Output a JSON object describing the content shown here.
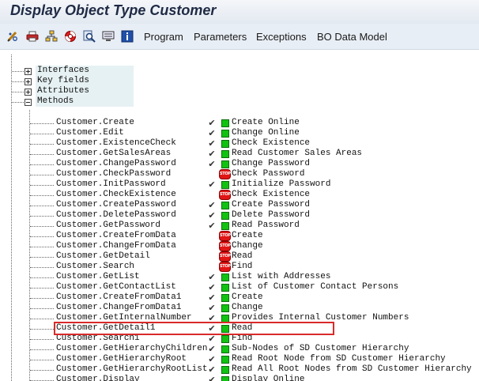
{
  "window": {
    "title": "Display Object Type Customer"
  },
  "toolbar": {
    "icons": [
      "pencil-glasses-icon",
      "printer-icon",
      "hierarchy-icon",
      "lifebuoy-icon",
      "magnifier-icon",
      "monitor-icon",
      "info-icon"
    ],
    "menus": [
      "Program",
      "Parameters",
      "Exceptions",
      "BO Data Model"
    ]
  },
  "tree": {
    "nodes": [
      "Interfaces",
      "Key fields",
      "Attributes",
      "Methods"
    ]
  },
  "status_icons": {
    "green": "green-square-icon",
    "stop": "stop-icon",
    "stop_text": "STOP",
    "check": "✔"
  },
  "methods": [
    {
      "name": "Customer.Create",
      "status": "ok",
      "desc": "Create Online"
    },
    {
      "name": "Customer.Edit",
      "status": "ok",
      "desc": "Change Online"
    },
    {
      "name": "Customer.ExistenceCheck",
      "status": "ok",
      "desc": "Check Existence"
    },
    {
      "name": "Customer.GetSalesAreas",
      "status": "ok",
      "desc": "Read Customer Sales Areas"
    },
    {
      "name": "Customer.ChangePassword",
      "status": "ok",
      "desc": "Change Password"
    },
    {
      "name": "Customer.CheckPassword",
      "status": "stop",
      "desc": "Check Password"
    },
    {
      "name": "Customer.InitPassword",
      "status": "ok",
      "desc": "Initialize Password"
    },
    {
      "name": "Customer.CheckExistence",
      "status": "stop",
      "desc": "Check Existence"
    },
    {
      "name": "Customer.CreatePassword",
      "status": "ok",
      "desc": "Create Password"
    },
    {
      "name": "Customer.DeletePassword",
      "status": "ok",
      "desc": "Delete Password"
    },
    {
      "name": "Customer.GetPassword",
      "status": "ok",
      "desc": "Read Password"
    },
    {
      "name": "Customer.CreateFromData",
      "status": "stop",
      "desc": "Create"
    },
    {
      "name": "Customer.ChangeFromData",
      "status": "stop",
      "desc": "Change"
    },
    {
      "name": "Customer.GetDetail",
      "status": "stop",
      "desc": "Read"
    },
    {
      "name": "Customer.Search",
      "status": "stop",
      "desc": "Find"
    },
    {
      "name": "Customer.GetList",
      "status": "ok",
      "desc": "List with Addresses",
      "highlighted": true
    },
    {
      "name": "Customer.GetContactList",
      "status": "ok",
      "desc": "List of Customer Contact Persons"
    },
    {
      "name": "Customer.CreateFromData1",
      "status": "ok",
      "desc": "Create"
    },
    {
      "name": "Customer.ChangeFromData1",
      "status": "ok",
      "desc": "Change"
    },
    {
      "name": "Customer.GetInternalNumber",
      "status": "ok",
      "desc": "Provides Internal Customer Numbers"
    },
    {
      "name": "Customer.GetDetail1",
      "status": "ok",
      "desc": "Read"
    },
    {
      "name": "Customer.Search1",
      "status": "ok",
      "desc": "Find"
    },
    {
      "name": "Customer.GetHierarchyChildren",
      "status": "ok",
      "desc": "Sub-Nodes of SD Customer Hierarchy"
    },
    {
      "name": "Customer.GetHierarchyRoot",
      "status": "ok",
      "desc": "Read Root Node from SD Customer Hierarchy"
    },
    {
      "name": "Customer.GetHierarchyRootList",
      "status": "ok",
      "desc": "Read All Root Nodes from SD Customer Hierarchy"
    },
    {
      "name": "Customer.Display",
      "status": "ok",
      "desc": "Display Online"
    }
  ]
}
